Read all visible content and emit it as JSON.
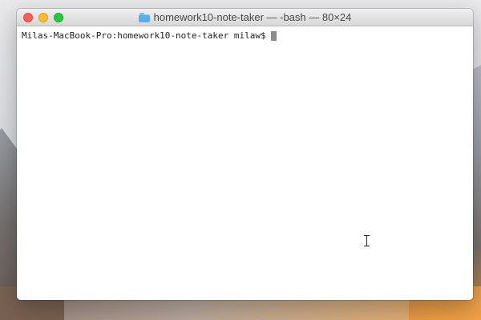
{
  "window": {
    "title": "homework10-note-taker — -bash — 80×24",
    "folder_icon": "folder-icon"
  },
  "terminal": {
    "prompt": "Milas-MacBook-Pro:homework10-note-taker milaw$"
  },
  "colors": {
    "close": "#fe5f57",
    "minimize": "#febb2e",
    "zoom": "#28c840",
    "terminal_background": "#ffffff",
    "terminal_text": "#1f1f1f",
    "cursor": "#8d8d8d"
  },
  "icons": {
    "text_cursor": "i-beam-cursor-icon"
  }
}
